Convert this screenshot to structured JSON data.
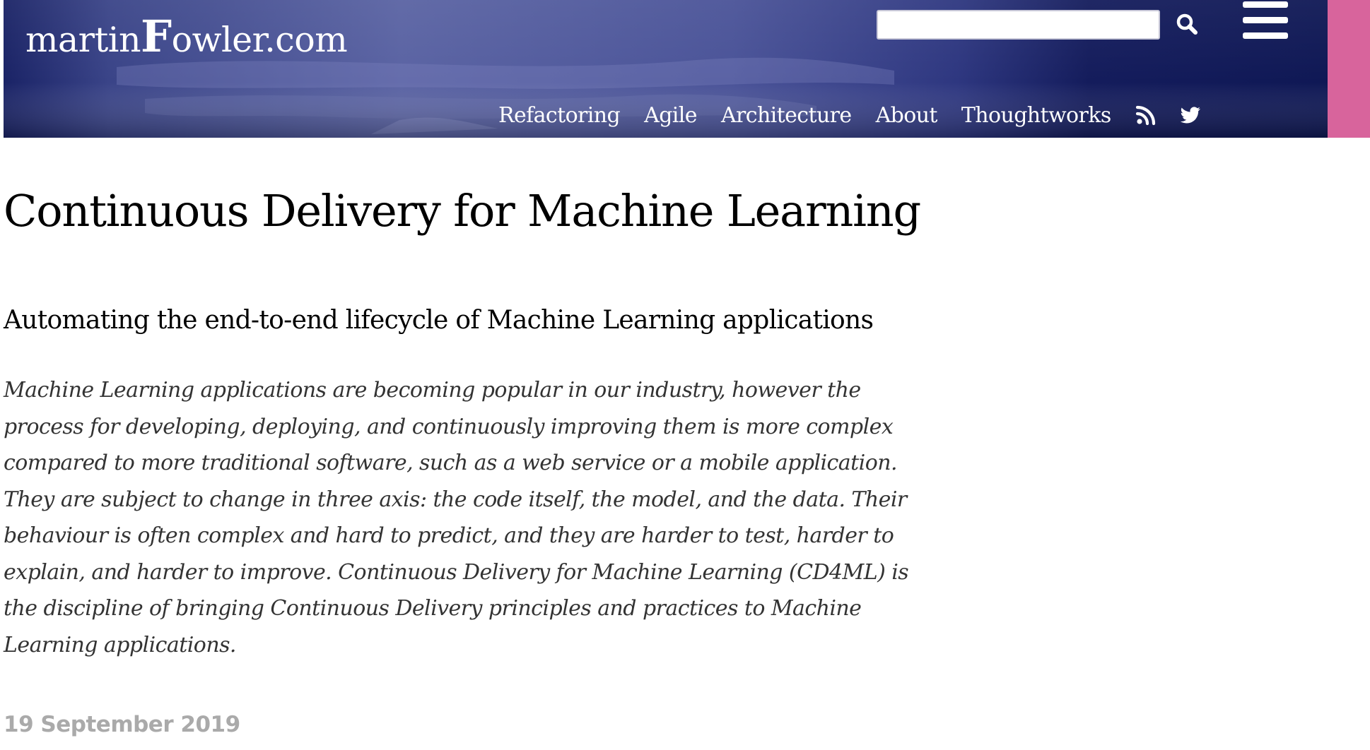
{
  "header": {
    "logo_prefix": "martin",
    "logo_initial": "F",
    "logo_suffix": "owler.com",
    "search": {
      "value": "",
      "placeholder": ""
    },
    "search_icon": "search-icon",
    "menu_icon": "hamburger-menu-icon",
    "nav": [
      {
        "label": "Refactoring"
      },
      {
        "label": "Agile"
      },
      {
        "label": "Architecture"
      },
      {
        "label": "About"
      },
      {
        "label": "Thoughtworks"
      }
    ],
    "social_icons": [
      "rss-icon",
      "twitter-icon"
    ],
    "colors": {
      "header_background": "#101a57",
      "accent_bar": "#d8649c"
    }
  },
  "article": {
    "title": "Continuous Delivery for Machine Learning",
    "subtitle": "Automating the end-to-end lifecycle of Machine Learning applications",
    "abstract": "Machine Learning applications are becoming popular in our industry, however the process for developing, deploying, and continuously improving them is more complex compared to more traditional software, such as a web service or a mobile application. They are subject to change in three axis: the code itself, the model, and the data. Their behaviour is often complex and hard to predict, and they are harder to test, harder to explain, and harder to improve. Continuous Delivery for Machine Learning (CD4ML) is the discipline of bringing Continuous Delivery principles and practices to Machine Learning applications.",
    "date": "19 September 2019"
  }
}
